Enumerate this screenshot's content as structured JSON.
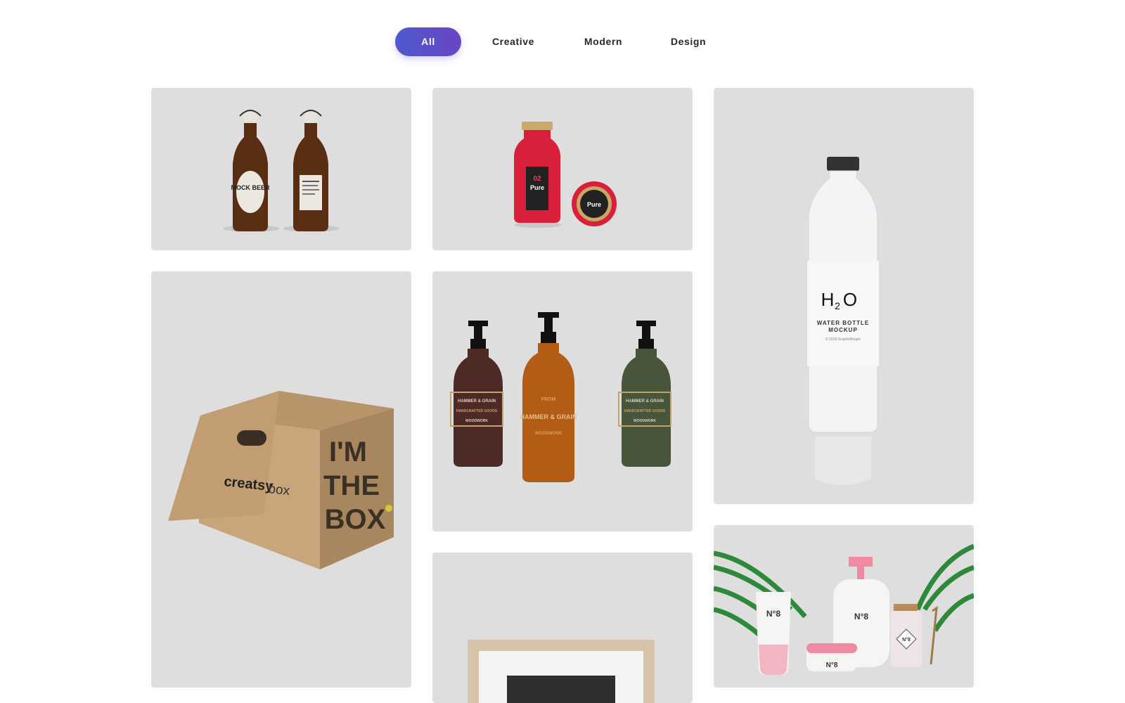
{
  "filters": {
    "all": "All",
    "creative": "Creative",
    "modern": "Modern",
    "design": "Design"
  },
  "cards": {
    "beer": {
      "label_left": "MOCK BEER"
    },
    "juice": {
      "number": "02",
      "brand": "Pure"
    },
    "water": {
      "h2o": "H",
      "sub": "2",
      "o": "O",
      "line1": "WATER BOTTLE",
      "line2": "MOCKUP",
      "credit": "© 2018 GraphicBurger"
    },
    "box": {
      "brand": "creatsy",
      "suffix": "box",
      "side1": "I'M",
      "side2": "THE",
      "side3": "BOX"
    },
    "pumps": {
      "top": "HAMMER & GRAIN",
      "mid": "HANDCRAFTED GOODS",
      "from": "FROM",
      "big": "HAMMER & GRAIN",
      "bottom": "WOODWORK"
    },
    "cosmetics": {
      "mark": "N°8"
    }
  },
  "colors": {
    "accent_start": "#4e59cf",
    "accent_end": "#6a44c4",
    "card_bg": "#dedede"
  }
}
